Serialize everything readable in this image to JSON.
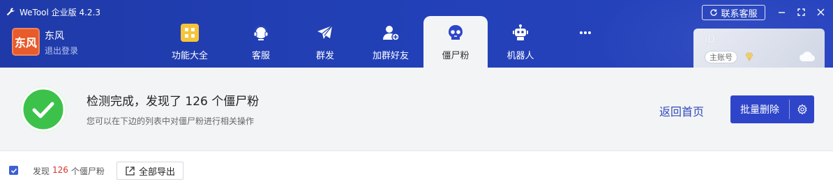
{
  "app": {
    "title": "WeTool 企业版 4.2.3"
  },
  "header": {
    "service_button": "联系客服"
  },
  "brand": {
    "logo_text": "东风",
    "name": "东风",
    "logout": "退出登录"
  },
  "tabs": [
    {
      "label": "功能大全",
      "icon": "grid-apps-icon"
    },
    {
      "label": "客服",
      "icon": "headset-icon"
    },
    {
      "label": "群发",
      "icon": "paper-plane-icon"
    },
    {
      "label": "加群好友",
      "icon": "add-user-icon"
    },
    {
      "label": "僵尸粉",
      "icon": "skull-icon",
      "active": true
    },
    {
      "label": "机器人",
      "icon": "robot-icon"
    },
    {
      "label": "",
      "icon": "more-icon"
    }
  ],
  "account": {
    "id_label": "ID:",
    "badge": "主账号"
  },
  "result": {
    "title": "检测完成，发现了 126 个僵尸粉",
    "subtitle": "您可以在下边的列表中对僵尸粉进行相关操作",
    "back_home": "返回首页",
    "batch_delete": "批量删除"
  },
  "toolbar": {
    "found_prefix": "发现",
    "found_count": "126",
    "found_suffix": "个僵尸粉",
    "export_all": "全部导出",
    "select_all_checked": true
  },
  "colors": {
    "header_bg": "#2240b6",
    "accent": "#2f45c9",
    "success": "#3cc24a",
    "count_red": "#d9302a",
    "brand_logo": "#e85b2a"
  }
}
